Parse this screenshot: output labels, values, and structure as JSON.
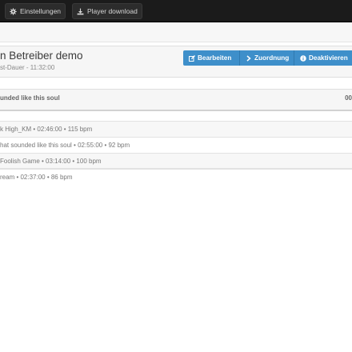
{
  "toolbar": {
    "settings_label": "Einstellungen",
    "settings_icon": "gear-icon",
    "download_label": "Player download",
    "download_icon": "download-icon"
  },
  "header": {
    "title": "n Betreiber demo",
    "subtitle": "st-Dauer - 11:32:00"
  },
  "actions": {
    "edit_label": "Bearbeiten",
    "edit_icon": "edit-icon",
    "assign_label": "Zuordnung",
    "assign_icon": "chevron-right-icon",
    "deactivate_label": "Deaktivieren",
    "deactivate_icon": "info-circle-icon",
    "accent_color": "#3e8fca"
  },
  "section": {
    "title": "unded like this soul",
    "right_text": "00"
  },
  "tracks": [
    {
      "text": "k High_KM • 02:46:00 • 115 bpm"
    },
    {
      "text": "hat sounded like this soul • 02:55:00 • 92 bpm"
    },
    {
      "text": "Foolish Game • 03:14:00 • 100 bpm"
    },
    {
      "text": "ream • 02:37:00 • 86 bpm"
    }
  ]
}
